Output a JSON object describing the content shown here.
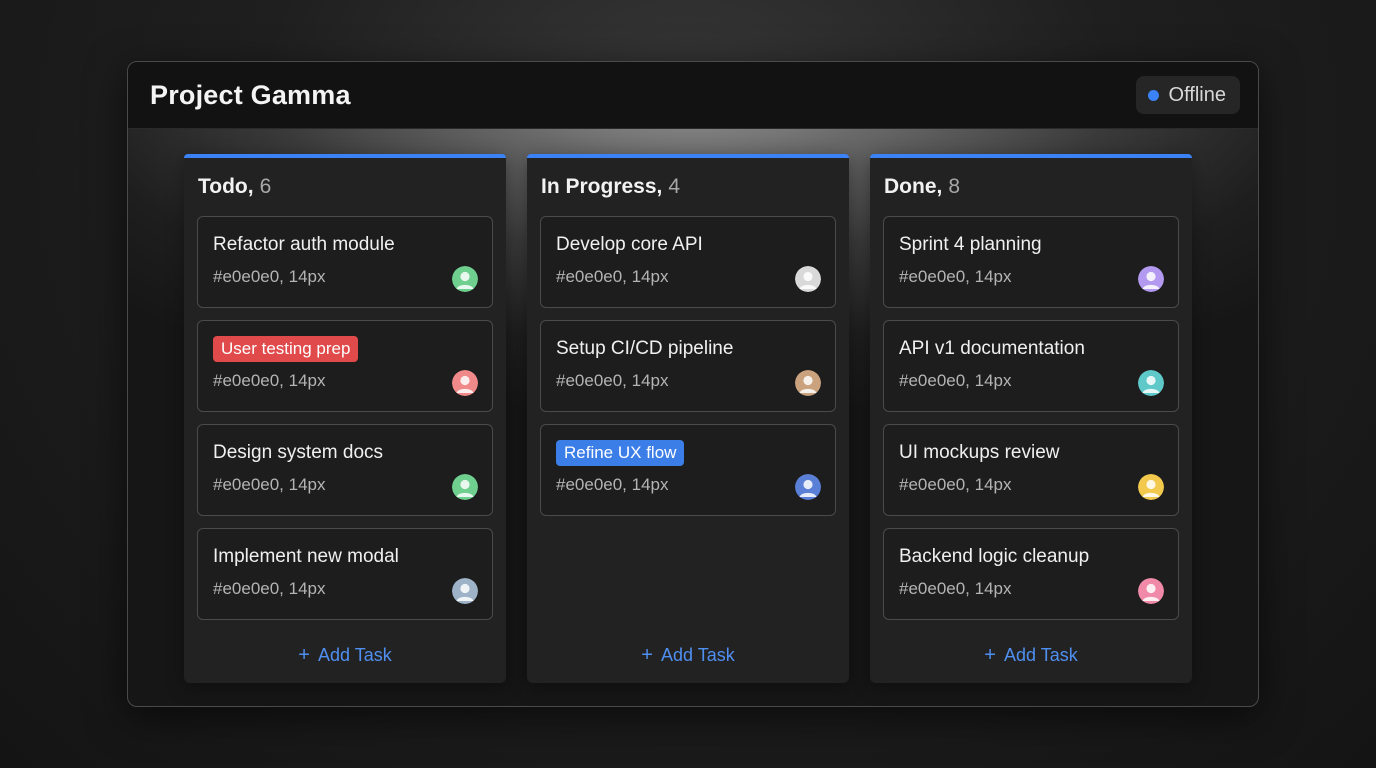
{
  "app": {
    "title": "Project Gamma",
    "status": "Offline",
    "status_color": "#3b82f6"
  },
  "add_task_label": "Add Task",
  "columns": [
    {
      "name": "Todo",
      "count": "6",
      "cards": [
        {
          "title": "Refactor auth module",
          "meta": "#e0e0e0, 14px",
          "avatar_color": "#6fcf8f"
        },
        {
          "tag": "User testing prep",
          "tag_color": "red",
          "meta": "#e0e0e0, 14px",
          "avatar_color": "#f08a8a"
        },
        {
          "title": "Design system docs",
          "meta": "#e0e0e0, 14px",
          "avatar_color": "#6fcf8f"
        },
        {
          "title": "Implement new modal",
          "meta": "#e0e0e0, 14px",
          "avatar_color": "#9fb3c8"
        }
      ]
    },
    {
      "name": "In Progress",
      "count": "4",
      "cards": [
        {
          "title": "Develop core API",
          "meta": "#e0e0e0, 14px",
          "avatar_color": "#d9d9d9"
        },
        {
          "title": "Setup CI/CD pipeline",
          "meta": "#e0e0e0, 14px",
          "avatar_color": "#caa27e"
        },
        {
          "tag": "Refine UX flow",
          "tag_color": "blue",
          "meta": "#e0e0e0, 14px",
          "avatar_color": "#5a7fd6"
        }
      ]
    },
    {
      "name": "Done",
      "count": "8",
      "cards": [
        {
          "title": "Sprint 4 planning",
          "meta": "#e0e0e0, 14px",
          "avatar_color": "#b39af0"
        },
        {
          "title": "API v1 documentation",
          "meta": "#e0e0e0, 14px",
          "avatar_color": "#5fc9c9"
        },
        {
          "title": "UI mockups review",
          "meta": "#e0e0e0, 14px",
          "avatar_color": "#f2c94c"
        },
        {
          "title": "Backend logic cleanup",
          "meta": "#e0e0e0, 14px",
          "avatar_color": "#f08aa8"
        }
      ]
    }
  ]
}
